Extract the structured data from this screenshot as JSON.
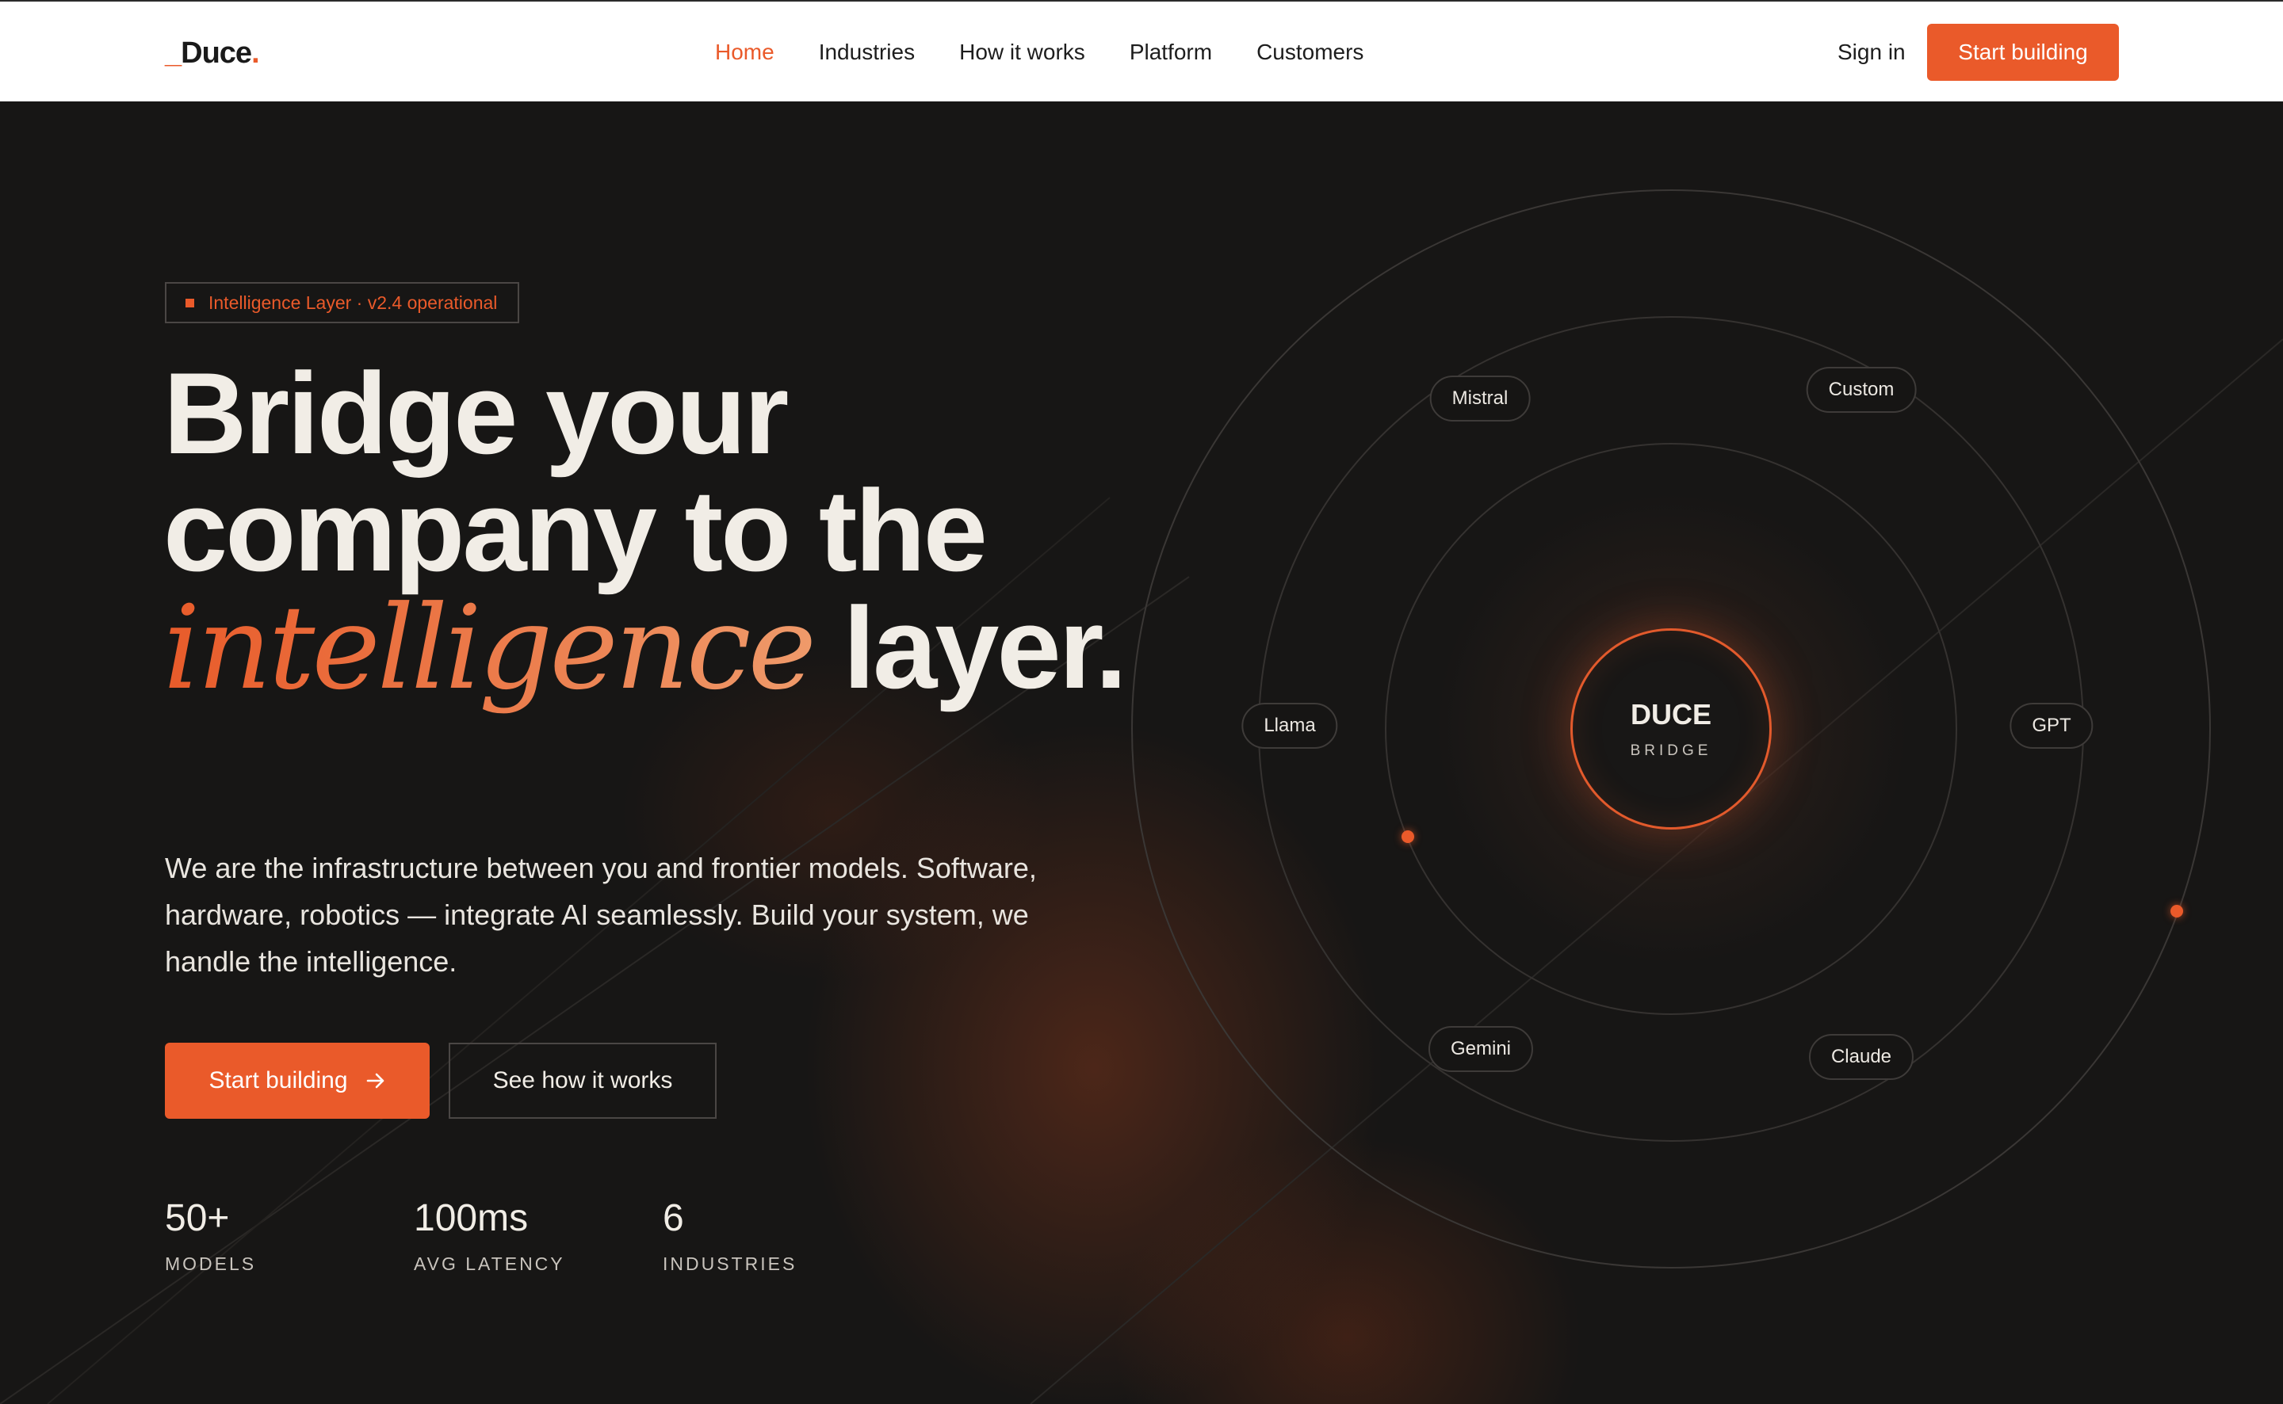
{
  "nav": {
    "logo": {
      "prefix": "_",
      "name": "Duce",
      "suffix": "."
    },
    "links": [
      {
        "label": "Home",
        "active": true
      },
      {
        "label": "Industries",
        "active": false
      },
      {
        "label": "How it works",
        "active": false
      },
      {
        "label": "Platform",
        "active": false
      },
      {
        "label": "Customers",
        "active": false
      }
    ],
    "signin": "Sign in",
    "cta": "Start building"
  },
  "hero": {
    "badge": "Intelligence Layer · v2.4 operational",
    "headline": {
      "line1": "Bridge your",
      "line2": "company to the",
      "italic": "intelligence",
      "tail": " layer."
    },
    "lead": "We are the infrastructure between you and frontier models. Software, hardware, robotics — integrate AI seamlessly. Build your system, we handle the intelligence.",
    "primary_cta": "Start building",
    "primary_cta_icon": "arrow-right-icon",
    "secondary_cta": "See how it works",
    "stats": [
      {
        "value": "50+",
        "label": "MODELS"
      },
      {
        "value": "100ms",
        "label": "AVG LATENCY"
      },
      {
        "value": "6",
        "label": "INDUSTRIES"
      }
    ]
  },
  "orbit": {
    "core_title": "DUCE",
    "core_subtitle": "BRIDGE",
    "models": [
      "Mistral",
      "Custom",
      "Llama",
      "GPT",
      "Gemini",
      "Claude"
    ]
  },
  "colors": {
    "accent": "#ea5a2a",
    "background": "#171615",
    "text": "#f1ede6",
    "nav_bg": "#ffffff"
  }
}
